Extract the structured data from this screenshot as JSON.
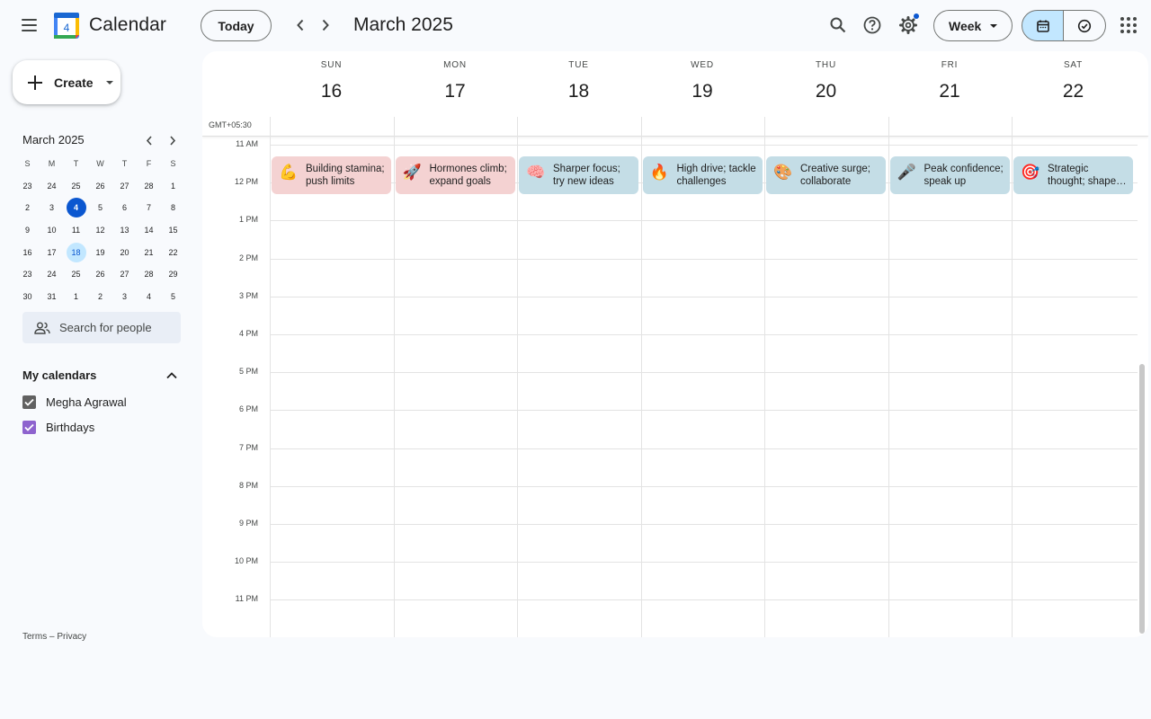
{
  "header": {
    "app_title": "Calendar",
    "logo_day": "4",
    "today_label": "Today",
    "current_period": "March 2025",
    "view_label": "Week",
    "icons": [
      "menu-icon",
      "prev-icon",
      "next-icon",
      "search-icon",
      "help-icon",
      "settings-icon",
      "calendar-icon",
      "tasks-icon",
      "apps-icon"
    ]
  },
  "sidebar": {
    "create_label": "Create",
    "mini_calendar": {
      "title": "March 2025",
      "weekdays": [
        "S",
        "M",
        "T",
        "W",
        "T",
        "F",
        "S"
      ],
      "weeks": [
        [
          "23",
          "24",
          "25",
          "26",
          "27",
          "28",
          "1"
        ],
        [
          "2",
          "3",
          "4",
          "5",
          "6",
          "7",
          "8"
        ],
        [
          "9",
          "10",
          "11",
          "12",
          "13",
          "14",
          "15"
        ],
        [
          "16",
          "17",
          "18",
          "19",
          "20",
          "21",
          "22"
        ],
        [
          "23",
          "24",
          "25",
          "26",
          "27",
          "28",
          "29"
        ],
        [
          "30",
          "31",
          "1",
          "2",
          "3",
          "4",
          "5"
        ]
      ],
      "today": "4",
      "selected": "18"
    },
    "people_search_placeholder": "Search for people",
    "my_calendars_label": "My calendars",
    "calendars": [
      {
        "name": "Megha Agrawal",
        "color": "#616161"
      },
      {
        "name": "Birthdays",
        "color": "#8e63ce"
      }
    ],
    "footer": {
      "terms": "Terms",
      "separator": "–",
      "privacy": "Privacy"
    }
  },
  "week": {
    "timezone": "GMT+05:30",
    "days": [
      {
        "dow": "SUN",
        "date": "16"
      },
      {
        "dow": "MON",
        "date": "17"
      },
      {
        "dow": "TUE",
        "date": "18"
      },
      {
        "dow": "WED",
        "date": "19"
      },
      {
        "dow": "THU",
        "date": "20"
      },
      {
        "dow": "FRI",
        "date": "21"
      },
      {
        "dow": "SAT",
        "date": "22"
      }
    ],
    "hours": [
      "11 AM",
      "12 PM",
      "1 PM",
      "2 PM",
      "3 PM",
      "4 PM",
      "5 PM",
      "6 PM",
      "7 PM",
      "8 PM",
      "9 PM",
      "10 PM",
      "11 PM"
    ],
    "events": [
      {
        "emoji": "💪",
        "title": "Building stamina; push limits",
        "color": "#f4d2d2"
      },
      {
        "emoji": "🚀",
        "title": "Hormones climb; expand goals",
        "color": "#f4d2d2"
      },
      {
        "emoji": "🧠",
        "title": "Sharper focus; try new ideas",
        "color": "#c4dde6"
      },
      {
        "emoji": "🔥",
        "title": "High drive; tackle challenges",
        "color": "#c4dde6"
      },
      {
        "emoji": "🎨",
        "title": "Creative surge; collaborate",
        "color": "#c4dde6"
      },
      {
        "emoji": "🎤",
        "title": "Peak confidence; speak up",
        "color": "#c4dde6"
      },
      {
        "emoji": "🎯",
        "title": "Strategic thought; shape plans",
        "color": "#c4dde6"
      }
    ]
  }
}
